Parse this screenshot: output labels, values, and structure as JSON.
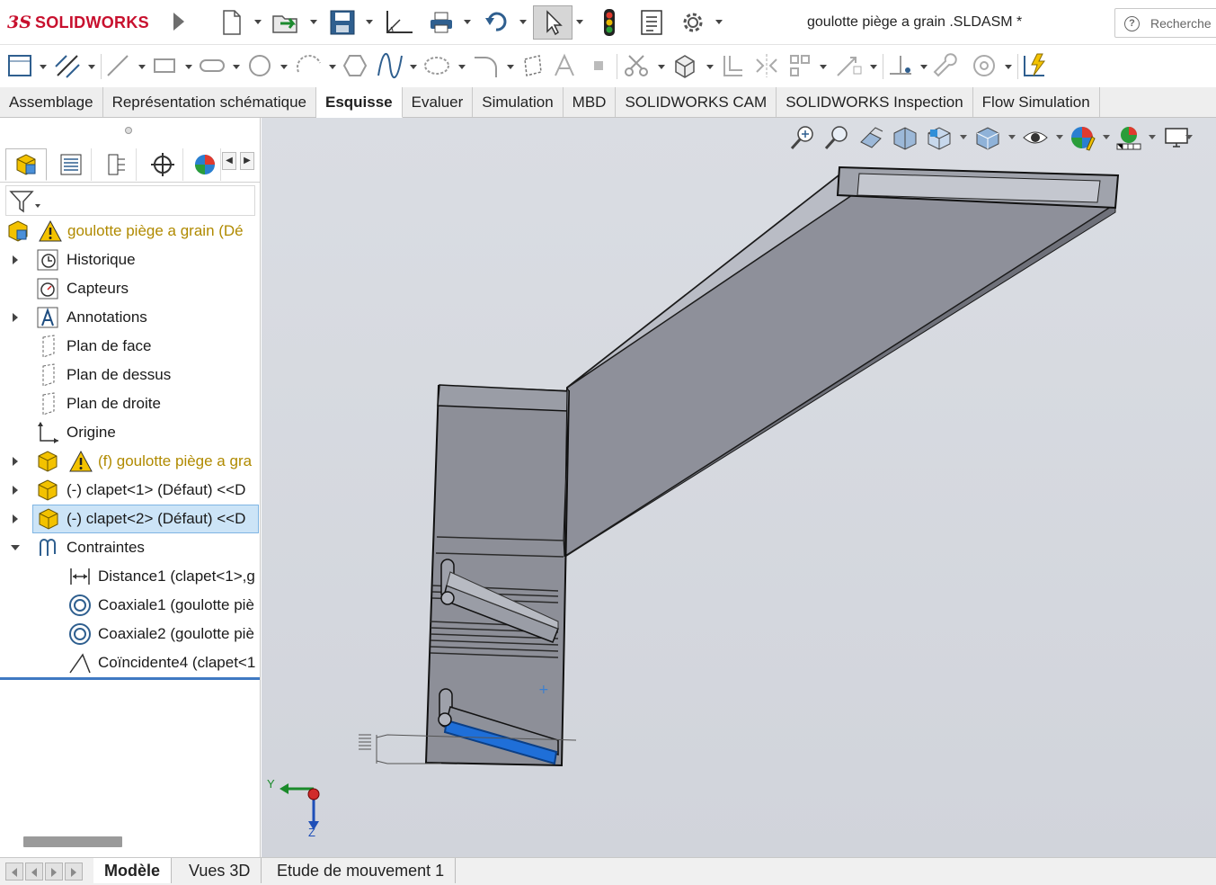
{
  "app": {
    "brand_ds": "3S",
    "brand_name": "SOLIDWORKS",
    "document_title": "goulotte piège a grain .SLDASM *",
    "search_placeholder": "Recherche",
    "search_help": "?"
  },
  "quick_access": [
    "new-icon",
    "open-icon",
    "save-icon",
    "print-preview-icon",
    "print-icon",
    "undo-icon",
    "select-icon",
    "rebuild-icon",
    "file-properties-icon",
    "options-icon"
  ],
  "command_tabs": [
    {
      "label": "Assemblage",
      "active": false
    },
    {
      "label": "Représentation schématique",
      "active": false
    },
    {
      "label": "Esquisse",
      "active": true
    },
    {
      "label": "Evaluer",
      "active": false
    },
    {
      "label": "Simulation",
      "active": false
    },
    {
      "label": "MBD",
      "active": false
    },
    {
      "label": "SOLIDWORKS CAM",
      "active": false
    },
    {
      "label": "SOLIDWORKS Inspection",
      "active": false
    },
    {
      "label": "Flow Simulation",
      "active": false
    }
  ],
  "tree": {
    "root": "goulotte piège a grain  (Dé",
    "items": [
      {
        "label": "Historique",
        "icon": "history-icon"
      },
      {
        "label": "Capteurs",
        "icon": "sensor-icon"
      },
      {
        "label": "Annotations",
        "icon": "annotations-icon"
      },
      {
        "label": "Plan de face",
        "icon": "plane-icon"
      },
      {
        "label": "Plan de dessus",
        "icon": "plane-icon"
      },
      {
        "label": "Plan de droite",
        "icon": "plane-icon"
      },
      {
        "label": "Origine",
        "icon": "origin-icon"
      },
      {
        "label": "(f) goulotte piège a gra",
        "icon": "part-icon"
      },
      {
        "label": "(-) clapet<1> (Défaut) <<D",
        "icon": "part-icon"
      },
      {
        "label": "(-) clapet<2> (Défaut) <<D",
        "icon": "part-icon"
      },
      {
        "label": "Contraintes",
        "icon": "mates-icon"
      },
      {
        "label": "Distance1 (clapet<1>,g",
        "icon": "distance-icon"
      },
      {
        "label": "Coaxiale1 (goulotte piè",
        "icon": "coaxial-icon"
      },
      {
        "label": "Coaxiale2 (goulotte piè",
        "icon": "coaxial-icon"
      },
      {
        "label": "Coïncidente4 (clapet<1",
        "icon": "coincident-icon"
      }
    ]
  },
  "triad": {
    "y": "Y",
    "z": "Z"
  },
  "bottom_tabs": [
    {
      "label": "Modèle",
      "active": true
    },
    {
      "label": "Vues 3D",
      "active": false
    },
    {
      "label": "Etude de mouvement 1",
      "active": false
    }
  ],
  "colors": {
    "brand_red": "#c8102e",
    "selection_blue": "#cce4f7",
    "highlight_edge": "#1f6fd8",
    "warning_yellow": "#f3c200"
  }
}
